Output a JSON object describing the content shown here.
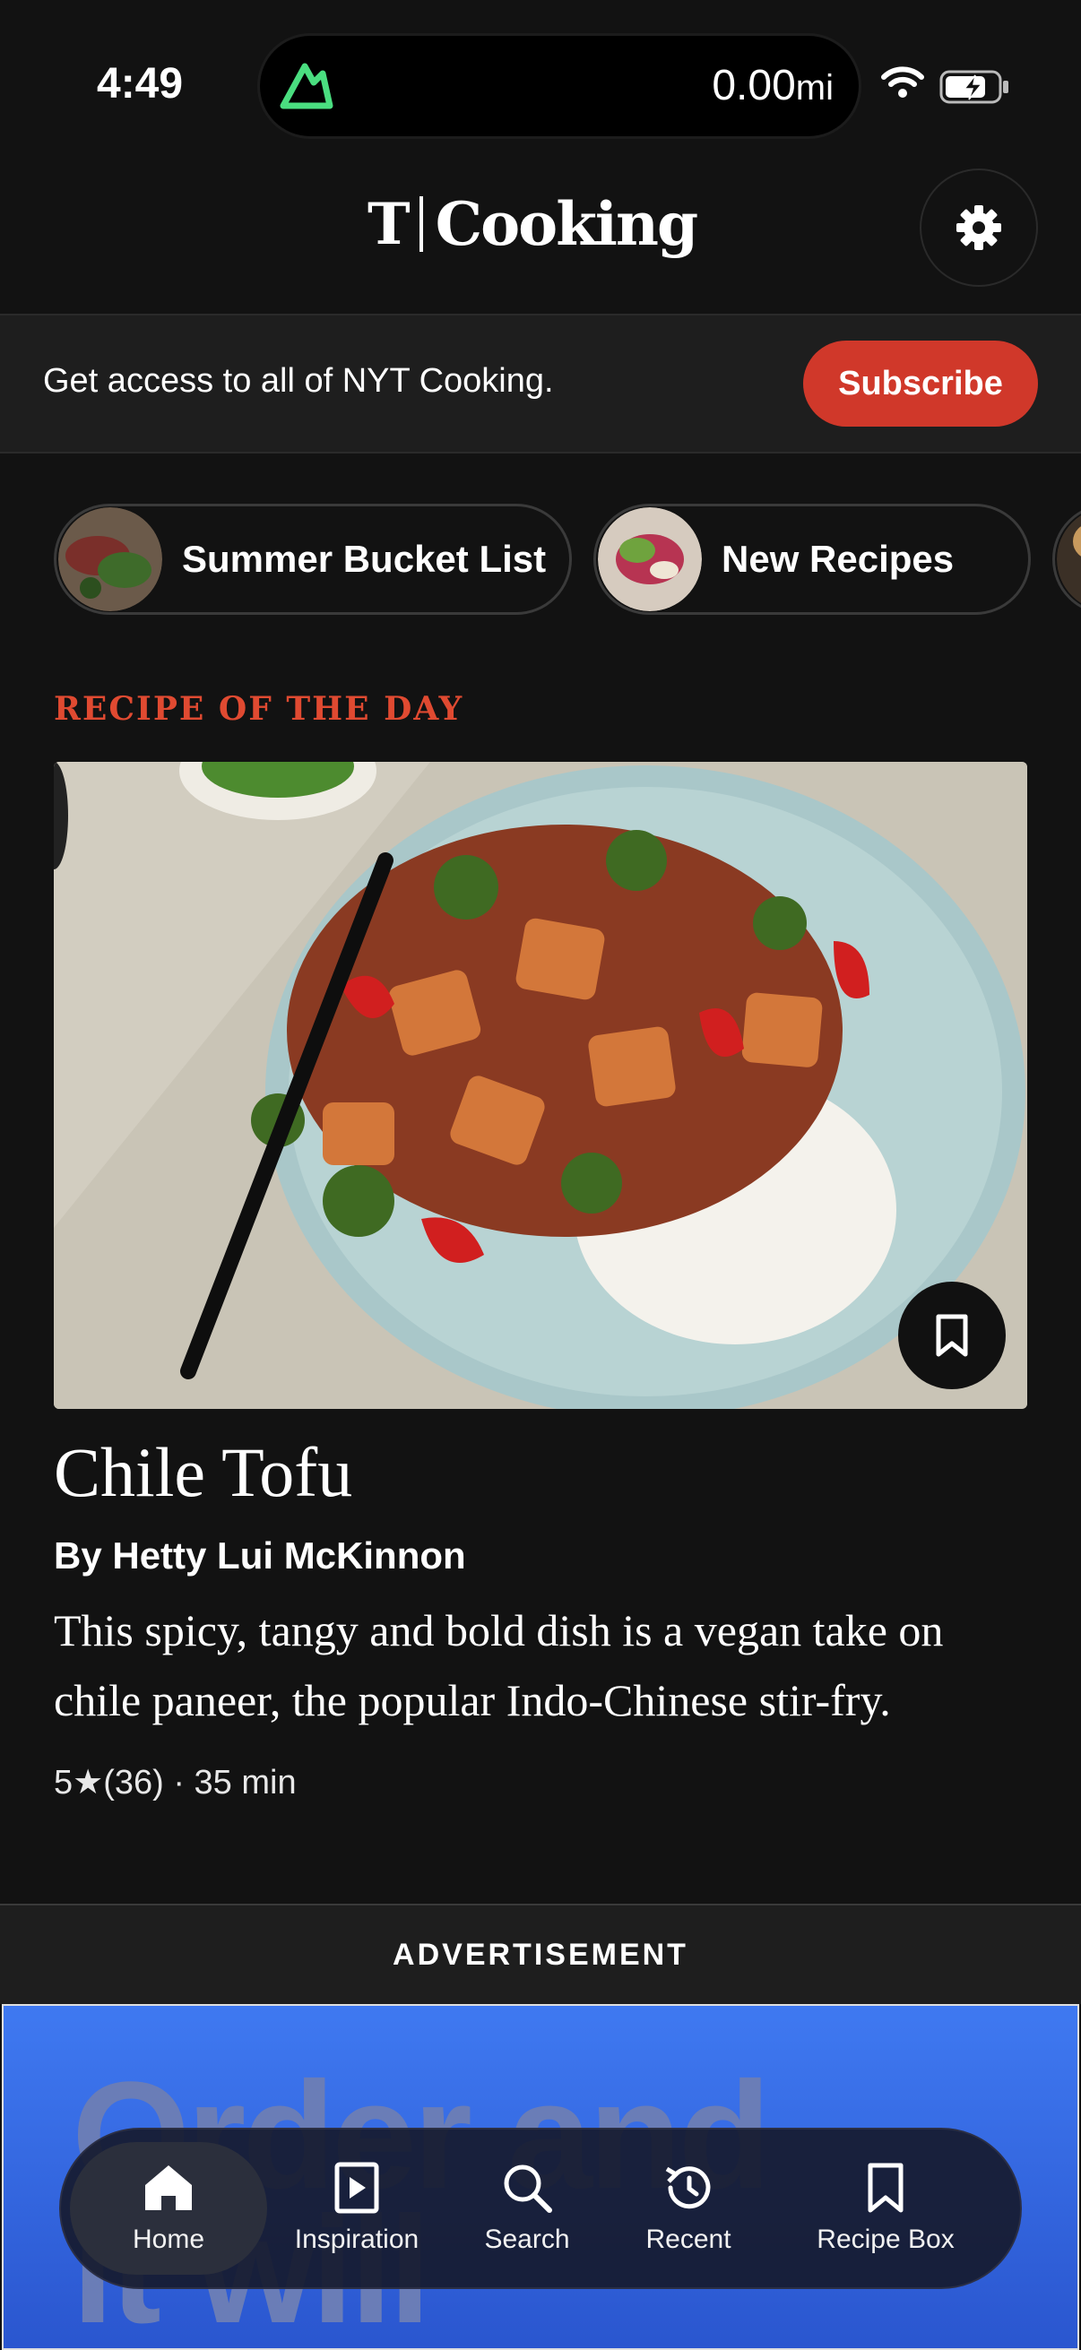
{
  "status": {
    "time": "4:49",
    "distance_value": "0.00",
    "distance_unit": "mi"
  },
  "header": {
    "logo_mark": "T",
    "logo_text": "Cooking"
  },
  "banner": {
    "text": "Get access to all of NYT Cooking.",
    "subscribe_label": "Subscribe"
  },
  "chips": [
    {
      "label": "Summer Bucket List"
    },
    {
      "label": "New Recipes"
    },
    {
      "label": ""
    }
  ],
  "rotd": {
    "section_label": "RECIPE OF THE DAY",
    "title": "Chile Tofu",
    "author": "By Hetty Lui McKinnon",
    "description": "This spicy, tangy and bold dish is a vegan take on chile paneer, the popular Indo-Chinese stir-fry.",
    "meta": "5★(36) · 35 min"
  },
  "ad": {
    "label": "ADVERTISEMENT",
    "text_line1": "Order and",
    "text_line2": "it will"
  },
  "tabs": [
    {
      "label": "Home",
      "icon": "home-icon",
      "active": true
    },
    {
      "label": "Inspiration",
      "icon": "play-icon"
    },
    {
      "label": "Search",
      "icon": "search-icon"
    },
    {
      "label": "Recent",
      "icon": "history-icon"
    },
    {
      "label": "Recipe Box",
      "icon": "bookmark-icon"
    }
  ],
  "colors": {
    "accent": "#d0382a",
    "section_label": "#e04a31",
    "background": "#121212"
  }
}
